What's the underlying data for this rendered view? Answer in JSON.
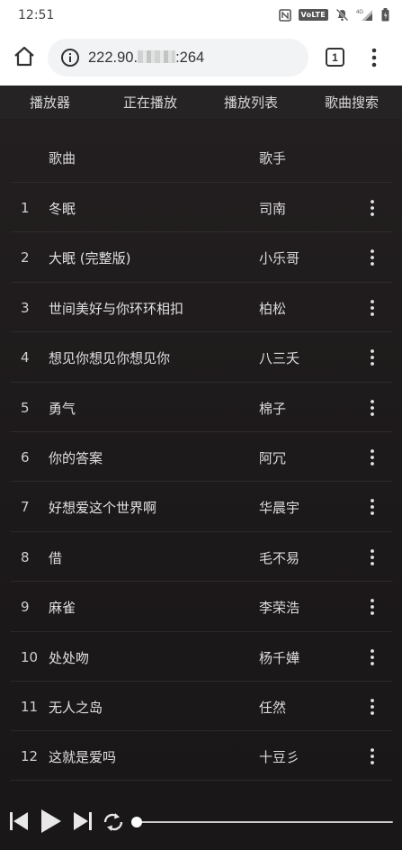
{
  "status_bar": {
    "time": "12:51",
    "volte_label": "VoLTE",
    "network_label": "4G"
  },
  "browser": {
    "url_prefix": "222.90.",
    "url_suffix": ":264",
    "tab_count": "1"
  },
  "nav": {
    "tabs": [
      "播放器",
      "正在播放",
      "播放列表",
      "歌曲搜索"
    ]
  },
  "table": {
    "headers": {
      "song": "歌曲",
      "artist": "歌手"
    },
    "rows": [
      {
        "index": "1",
        "title": "冬眠",
        "artist": "司南"
      },
      {
        "index": "2",
        "title": "大眠 (完整版)",
        "artist": "小乐哥"
      },
      {
        "index": "3",
        "title": "世间美好与你环环相扣",
        "artist": "柏松"
      },
      {
        "index": "4",
        "title": "想见你想见你想见你",
        "artist": "八三夭"
      },
      {
        "index": "5",
        "title": "勇气",
        "artist": "棉子"
      },
      {
        "index": "6",
        "title": "你的答案",
        "artist": "阿冗"
      },
      {
        "index": "7",
        "title": "好想爱这个世界啊",
        "artist": "华晨宇"
      },
      {
        "index": "8",
        "title": "借",
        "artist": "毛不易"
      },
      {
        "index": "9",
        "title": "麻雀",
        "artist": "李荣浩"
      },
      {
        "index": "10",
        "title": "处处吻",
        "artist": "杨千嬅"
      },
      {
        "index": "11",
        "title": "无人之岛",
        "artist": "任然"
      },
      {
        "index": "12",
        "title": "这就是爱吗",
        "artist": "十豆彡"
      }
    ]
  },
  "player": {
    "progress": 0.0
  },
  "colors": {
    "background": "#1f1c1d",
    "text": "#e0e0e0",
    "divider": "#2e2a2b"
  }
}
